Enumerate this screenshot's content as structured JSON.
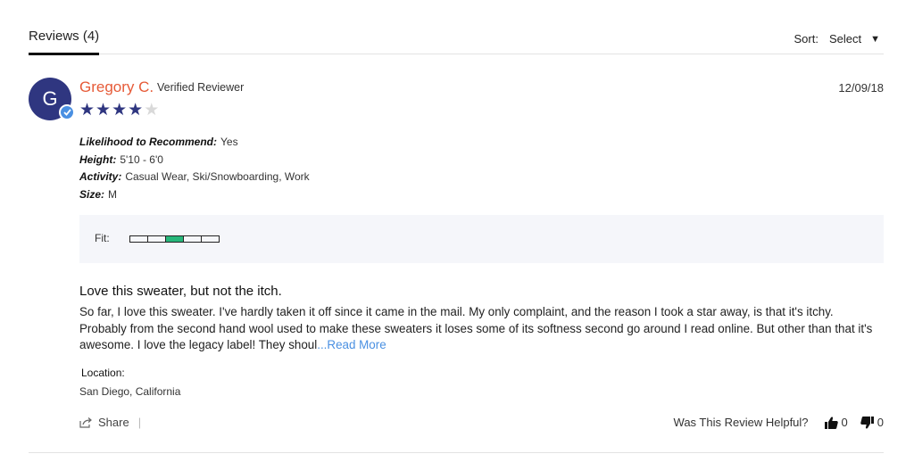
{
  "header": {
    "tab_label": "Reviews (4)",
    "sort_label": "Sort:",
    "sort_value": "Select"
  },
  "review": {
    "avatar_initial": "G",
    "reviewer_name": "Gregory C.",
    "verified_label": "Verified Reviewer",
    "date": "12/09/18",
    "rating": 4,
    "rating_max": 5,
    "attributes": [
      {
        "label": "Likelihood to Recommend:",
        "value": "Yes"
      },
      {
        "label": "Height:",
        "value": "5'10 - 6'0"
      },
      {
        "label": "Activity:",
        "value": "Casual Wear, Ski/Snowboarding, Work"
      },
      {
        "label": "Size:",
        "value": "M"
      }
    ],
    "fit_label": "Fit:",
    "fit_level": 3,
    "fit_segments": 5,
    "title": "Love this sweater, but not the itch.",
    "body": "So far, I love this sweater. I've hardly taken it off since it came in the mail. My only complaint, and the reason I took a star away, is that it's itchy. Probably from the second hand wool used to make these sweaters it loses some of its softness second go around I read online. But other than that it's awesome. I love the legacy label! They shoul",
    "read_more": "...Read More",
    "location_label": "Location:",
    "location_value": "San Diego, California"
  },
  "footer": {
    "share_label": "Share",
    "separator": "|",
    "helpful_label": "Was This Review Helpful?",
    "thumbs_up_count": "0",
    "thumbs_down_count": "0"
  },
  "colors": {
    "accent_name": "#e65a37",
    "star_color": "#2f3680",
    "fit_active": "#27b77a",
    "link": "#4a90e2"
  }
}
